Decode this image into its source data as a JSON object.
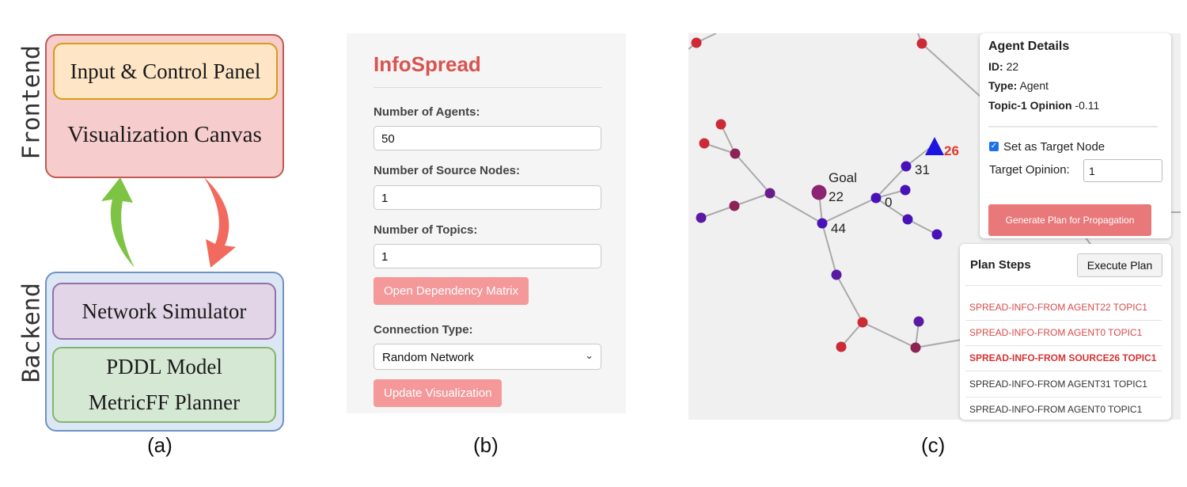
{
  "panel_a": {
    "frontend_label": "Frontend",
    "backend_label": "Backend",
    "input_control_panel": "Input & Control Panel",
    "visualization_canvas": "Visualization Canvas",
    "network_simulator": "Network Simulator",
    "pddl_model": "PDDL Model",
    "metricff_planner": "MetricFF Planner",
    "caption": "(a)",
    "colors": {
      "up_arrow": "#7dc444",
      "down_arrow": "#f26a5e"
    }
  },
  "panel_b": {
    "title": "InfoSpread",
    "num_agents_label": "Number of Agents:",
    "num_agents_value": "50",
    "num_sources_label": "Number of Source Nodes:",
    "num_sources_value": "1",
    "num_topics_label": "Number of Topics:",
    "num_topics_value": "1",
    "open_matrix_button": "Open Dependency Matrix",
    "connection_type_label": "Connection Type:",
    "connection_type_value": "Random Network",
    "update_button": "Update Visualization",
    "caption": "(b)",
    "colors": {
      "title": "#d9534f",
      "button": "#f4989a"
    }
  },
  "panel_c": {
    "node_labels": {
      "goal": "Goal",
      "n22": "22",
      "n44": "44",
      "n0": "0",
      "n31": "31",
      "n26": "26"
    },
    "agent_details": {
      "heading": "Agent Details",
      "id_label": "ID:",
      "id_value": "22",
      "type_label": "Type:",
      "type_value": "Agent",
      "opinion_label": "Topic-1 Opinion",
      "opinion_value": "-0.11",
      "target_checkbox_label": "Set as Target Node",
      "target_checked": true,
      "target_opinion_label": "Target Opinion:",
      "target_opinion_value": "1",
      "generate_button": "Generate Plan for Propagation"
    },
    "plan_steps": {
      "heading": "Plan Steps",
      "execute_button": "Execute Plan",
      "steps": [
        {
          "text": "SPREAD-INFO-FROM AGENT22 TOPIC1",
          "state": "done"
        },
        {
          "text": "SPREAD-INFO-FROM AGENT0 TOPIC1",
          "state": "done"
        },
        {
          "text": "SPREAD-INFO-FROM SOURCE26 TOPIC1",
          "state": "current"
        },
        {
          "text": "SPREAD-INFO-FROM AGENT31 TOPIC1",
          "state": "pending"
        },
        {
          "text": "SPREAD-INFO-FROM AGENT0 TOPIC1",
          "state": "pending"
        }
      ]
    },
    "caption": "(c)",
    "colors": {
      "red_node": "#cc2a35",
      "maroon_node": "#8c2355",
      "purple_node": "#4812b8",
      "source_node": "#1e14e0",
      "label_26": "#e03a2a"
    }
  }
}
